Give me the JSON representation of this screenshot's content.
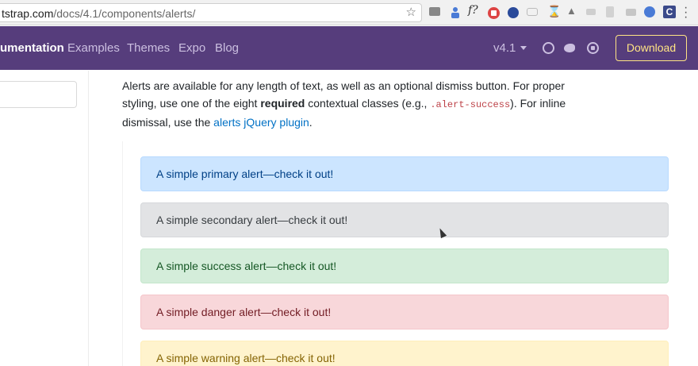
{
  "browser": {
    "url_host": "tstrap.com",
    "url_path": "/docs/4.1/components/alerts/",
    "extensions": [
      "camera-icon",
      "person-icon",
      "fx-icon",
      "lock-icon",
      "globe-icon",
      "dots-icon",
      "hourglass-icon",
      "witch-hat-icon",
      "grey-icon",
      "grey-icon",
      "grey-icon",
      "blue-circle-icon",
      "c-icon"
    ],
    "ext_c_label": "C",
    "ext_fx_label": "f?"
  },
  "navbar": {
    "brand": "umentation",
    "items": [
      "Examples",
      "Themes",
      "Expo",
      "Blog"
    ],
    "version": "v4.1",
    "download_label": "Download",
    "colors": {
      "background": "#563d7c",
      "download": "#ffe484"
    }
  },
  "sidebar": {
    "search_value": ""
  },
  "intro": {
    "part1": "Alerts are available for any length of text, as well as an optional dismiss button. For proper styling, use one of the eight ",
    "required": "required",
    "part2": " contextual classes (e.g., ",
    "code": ".alert-success",
    "part3": "). For inline dismissal, use the ",
    "link": "alerts jQuery plugin",
    "part4": "."
  },
  "alerts": [
    {
      "variant": "primary",
      "text": "A simple primary alert—check it out!"
    },
    {
      "variant": "secondary",
      "text": "A simple secondary alert—check it out!"
    },
    {
      "variant": "success",
      "text": "A simple success alert—check it out!"
    },
    {
      "variant": "danger",
      "text": "A simple danger alert—check it out!"
    },
    {
      "variant": "warning",
      "text": "A simple warning alert—check it out!"
    }
  ]
}
